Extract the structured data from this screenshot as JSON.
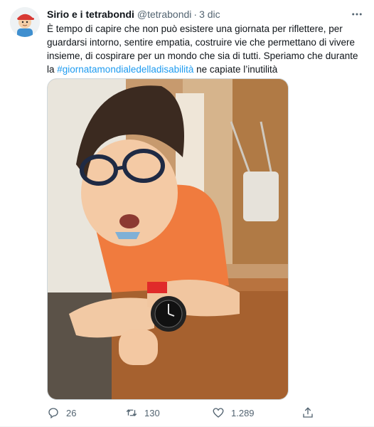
{
  "tweet": {
    "author_name": "Sirio e i tetrabondi",
    "handle": "@tetrabondi",
    "separator": "·",
    "date": "3 dic",
    "text_before": "È tempo di capire che non può esistere una giornata per riflettere, per guardarsi intorno, sentire empatia, costruire vie che permettano di vivere insieme, di cospirare per un mondo che sia di tutti. Speriamo che durante la ",
    "hashtag": "#giornatamondialedelladisabilità",
    "text_after": " ne capiate l’inutilità"
  },
  "actions": {
    "replies": "26",
    "retweets": "130",
    "likes": "1.289"
  },
  "colors": {
    "link": "#1d9bf0",
    "secondary_text": "#536471",
    "primary_text": "#0f1419"
  },
  "icons": [
    "avatar-illustration",
    "more-icon",
    "reply-icon",
    "retweet-icon",
    "like-icon",
    "share-icon"
  ]
}
